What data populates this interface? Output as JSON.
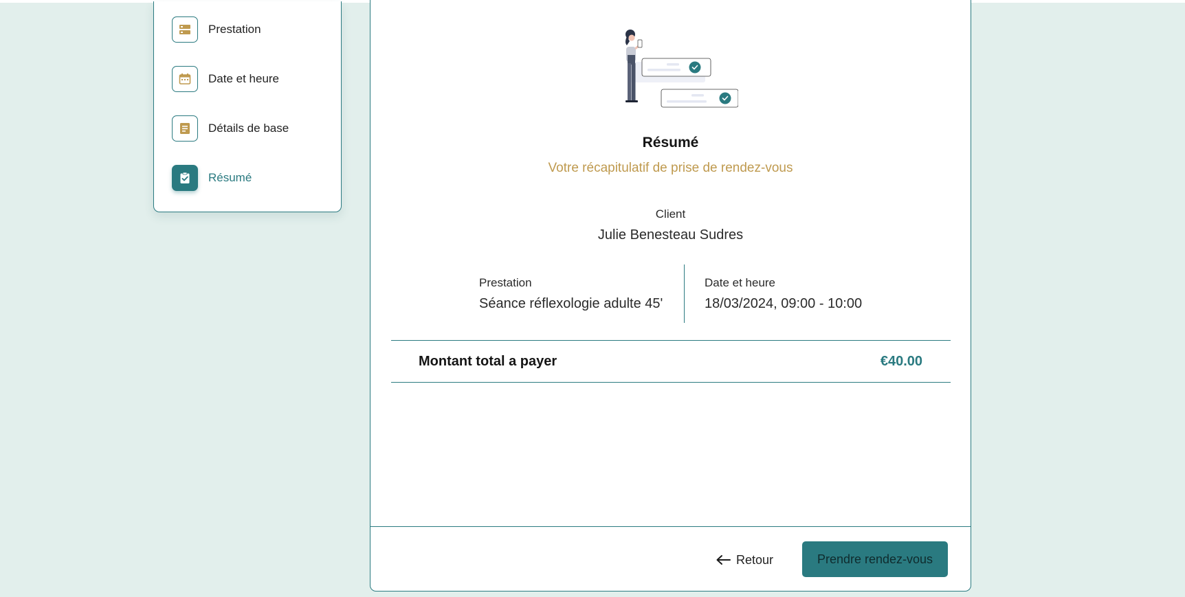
{
  "sidebar": {
    "items": [
      {
        "label": "Prestation",
        "icon": "server-icon",
        "active": false
      },
      {
        "label": "Date et heure",
        "icon": "calendar-icon",
        "active": false
      },
      {
        "label": "Détails de base",
        "icon": "document-icon",
        "active": false
      },
      {
        "label": "Résumé",
        "icon": "clipboard-check-icon",
        "active": true
      }
    ]
  },
  "summary": {
    "title": "Résumé",
    "subtitle": "Votre récapitulatif de prise de rendez-vous",
    "client_label": "Client",
    "client_value": "Julie Benesteau Sudres",
    "service_label": "Prestation",
    "service_value": "Séance réflexologie adulte 45'",
    "datetime_label": "Date et heure",
    "datetime_value": "18/03/2024, 09:00 - 10:00",
    "total_label": "Montant total a payer",
    "total_value": "€40.00"
  },
  "actions": {
    "back_label": "Retour",
    "submit_label": "Prendre rendez-vous"
  },
  "colors": {
    "accent": "#2a7a80",
    "gold": "#bf9a4f",
    "background": "#e2efec"
  }
}
